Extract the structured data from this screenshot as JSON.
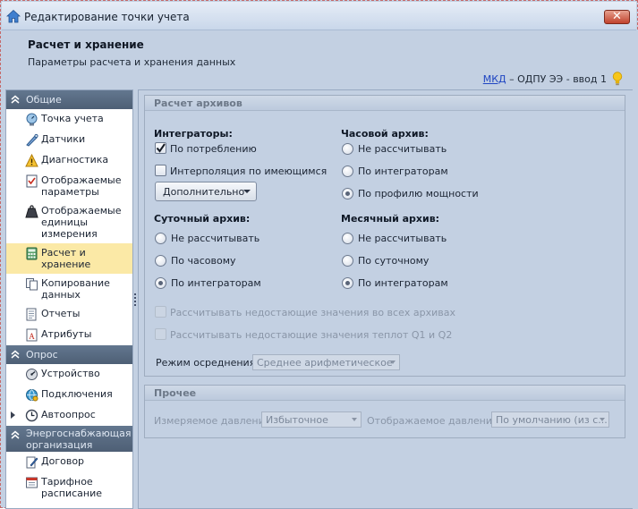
{
  "window": {
    "title": "Редактирование точки учета",
    "close_label": "✕"
  },
  "header": {
    "title": "Расчет и хранение",
    "subtitle": "Параметры расчета и хранения данных",
    "breadcrumb_link": "МКД",
    "breadcrumb_rest": " – ОДПУ ЭЭ - ввод 1"
  },
  "sidebar": {
    "groups": [
      {
        "label": "Общие",
        "items": [
          {
            "label": "Точка учета",
            "icon": "meter-icon"
          },
          {
            "label": "Датчики",
            "icon": "sensor-icon"
          },
          {
            "label": "Диагностика",
            "icon": "warning-icon"
          },
          {
            "label": "Отображаемые параметры",
            "icon": "checklist-icon"
          },
          {
            "label": "Отображаемые единицы измерения",
            "icon": "weight-icon"
          },
          {
            "label": "Расчет и хранение",
            "icon": "calculator-icon",
            "active": true
          },
          {
            "label": "Копирование данных",
            "icon": "copy-icon"
          },
          {
            "label": "Отчеты",
            "icon": "report-icon"
          },
          {
            "label": "Атрибуты",
            "icon": "attribute-icon"
          }
        ]
      },
      {
        "label": "Опрос",
        "items": [
          {
            "label": "Устройство",
            "icon": "device-icon"
          },
          {
            "label": "Подключения",
            "icon": "connection-icon"
          },
          {
            "label": "Автоопрос",
            "icon": "clock-icon"
          }
        ]
      },
      {
        "label": "Энергоснабжающая организация",
        "items": [
          {
            "label": "Договор",
            "icon": "contract-icon"
          },
          {
            "label": "Тарифное расписание",
            "icon": "tariff-icon"
          }
        ]
      }
    ]
  },
  "archives": {
    "section_title": "Расчет архивов",
    "integrators": {
      "label": "Интеграторы:",
      "by_consumption": "По потреблению",
      "by_consumption_checked": true,
      "interpolation": "Интерполяция по имеющимся",
      "interpolation_checked": false,
      "more_button": "Дополнительно"
    },
    "hourly": {
      "label": "Часовой архив:",
      "options": [
        "Не рассчитывать",
        "По интеграторам",
        "По профилю мощности"
      ],
      "selected": "По профилю мощности"
    },
    "daily": {
      "label": "Суточный архив:",
      "options": [
        "Не рассчитывать",
        "По часовому",
        "По интеграторам"
      ],
      "selected": "По интеграторам"
    },
    "monthly": {
      "label": "Месячный архив:",
      "options": [
        "Не рассчитывать",
        "По суточному",
        "По интеграторам"
      ],
      "selected": "По интеграторам"
    },
    "missing_all": "Рассчитывать недостающие значения во всех архивах",
    "missing_q": "Рассчитывать недостающие значения теплот Q1 и Q2",
    "averaging_label": "Режим осреднения:",
    "averaging_value": "Среднее арифметическое"
  },
  "other": {
    "section_title": "Прочее",
    "measured_pressure_label": "Измеряемое давление:",
    "measured_pressure_value": "Избыточное",
    "displayed_pressure_label": "Отображаемое давление:",
    "displayed_pressure_value": "По умолчанию (из с..."
  },
  "colors": {
    "accent_active": "#fbe9a6",
    "group_header": "#566a82",
    "panel_bg": "#c3d0e2",
    "link": "#1f45c2"
  }
}
